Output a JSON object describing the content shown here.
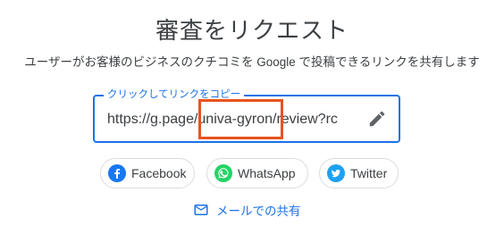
{
  "dialog": {
    "title": "審査をリクエスト",
    "subtitle": "ユーザーがお客様のビジネスのクチコミを Google で投稿できるリンクを共有します"
  },
  "link_field": {
    "label": "クリックしてリンクをコピー",
    "value": "https://g.page/univa-gyron/review?rc",
    "edit_icon": "pencil-icon"
  },
  "share": {
    "facebook": {
      "label": "Facebook",
      "icon": "facebook-icon",
      "color": "#1877f2"
    },
    "whatsapp": {
      "label": "WhatsApp",
      "icon": "whatsapp-icon",
      "color": "#25d366"
    },
    "twitter": {
      "label": "Twitter",
      "icon": "twitter-icon",
      "color": "#1da1f2"
    },
    "email": {
      "label": "メールでの共有",
      "icon": "mail-icon",
      "color": "#1a73e8"
    }
  },
  "colors": {
    "accent": "#1a73e8",
    "highlight_box": "#e8531f"
  }
}
